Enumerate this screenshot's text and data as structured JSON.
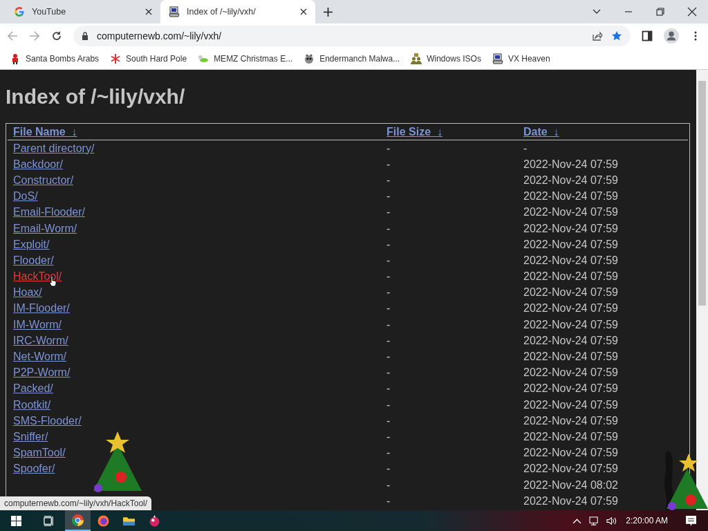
{
  "tabs": [
    {
      "title": "YouTube",
      "selected": false
    },
    {
      "title": "Index of /~lily/vxh/",
      "selected": true
    }
  ],
  "address": "computernewb.com/~lily/vxh/",
  "bookmarks": [
    {
      "label": "Santa Bombs Arabs"
    },
    {
      "label": "South Hard Pole"
    },
    {
      "label": "MEMZ Christmas E..."
    },
    {
      "label": "Endermanch Malwa..."
    },
    {
      "label": "Windows ISOs"
    },
    {
      "label": "VX Heaven"
    }
  ],
  "page": {
    "heading": "Index of /~lily/vxh/",
    "columns": [
      {
        "label": "File Name",
        "sort": "↓"
      },
      {
        "label": "File Size",
        "sort": "↓"
      },
      {
        "label": "Date",
        "sort": "↓"
      }
    ],
    "rows": [
      {
        "name": "Parent directory/",
        "size": "-",
        "date": "-",
        "hovered": false
      },
      {
        "name": "Backdoor/",
        "size": "-",
        "date": "2022-Nov-24 07:59",
        "hovered": false
      },
      {
        "name": "Constructor/",
        "size": "-",
        "date": "2022-Nov-24 07:59",
        "hovered": false
      },
      {
        "name": "DoS/",
        "size": "-",
        "date": "2022-Nov-24 07:59",
        "hovered": false
      },
      {
        "name": "Email-Flooder/",
        "size": "-",
        "date": "2022-Nov-24 07:59",
        "hovered": false
      },
      {
        "name": "Email-Worm/",
        "size": "-",
        "date": "2022-Nov-24 07:59",
        "hovered": false
      },
      {
        "name": "Exploit/",
        "size": "-",
        "date": "2022-Nov-24 07:59",
        "hovered": false
      },
      {
        "name": "Flooder/",
        "size": "-",
        "date": "2022-Nov-24 07:59",
        "hovered": false
      },
      {
        "name": "HackTool/",
        "size": "-",
        "date": "2022-Nov-24 07:59",
        "hovered": true
      },
      {
        "name": "Hoax/",
        "size": "-",
        "date": "2022-Nov-24 07:59",
        "hovered": false
      },
      {
        "name": "IM-Flooder/",
        "size": "-",
        "date": "2022-Nov-24 07:59",
        "hovered": false
      },
      {
        "name": "IM-Worm/",
        "size": "-",
        "date": "2022-Nov-24 07:59",
        "hovered": false
      },
      {
        "name": "IRC-Worm/",
        "size": "-",
        "date": "2022-Nov-24 07:59",
        "hovered": false
      },
      {
        "name": "Net-Worm/",
        "size": "-",
        "date": "2022-Nov-24 07:59",
        "hovered": false
      },
      {
        "name": "P2P-Worm/",
        "size": "-",
        "date": "2022-Nov-24 07:59",
        "hovered": false
      },
      {
        "name": "Packed/",
        "size": "-",
        "date": "2022-Nov-24 07:59",
        "hovered": false
      },
      {
        "name": "Rootkit/",
        "size": "-",
        "date": "2022-Nov-24 07:59",
        "hovered": false
      },
      {
        "name": "SMS-Flooder/",
        "size": "-",
        "date": "2022-Nov-24 07:59",
        "hovered": false
      },
      {
        "name": "Sniffer/",
        "size": "-",
        "date": "2022-Nov-24 07:59",
        "hovered": false
      },
      {
        "name": "SpamTool/",
        "size": "-",
        "date": "2022-Nov-24 07:59",
        "hovered": false
      },
      {
        "name": "Spoofer/",
        "size": "-",
        "date": "2022-Nov-24 07:59",
        "hovered": false
      },
      {
        "size": "-",
        "date": "2022-Nov-24 08:02"
      },
      {
        "size": "-",
        "date": "2022-Nov-24 07:59"
      }
    ]
  },
  "status_url": "computernewb.com/~lily/vxh/HackTool/",
  "taskbar": {
    "apps": [
      {
        "selected": true
      },
      {
        "selected": false
      },
      {
        "selected": false
      },
      {
        "selected": false
      }
    ],
    "clock": "2:20:00 AM"
  }
}
